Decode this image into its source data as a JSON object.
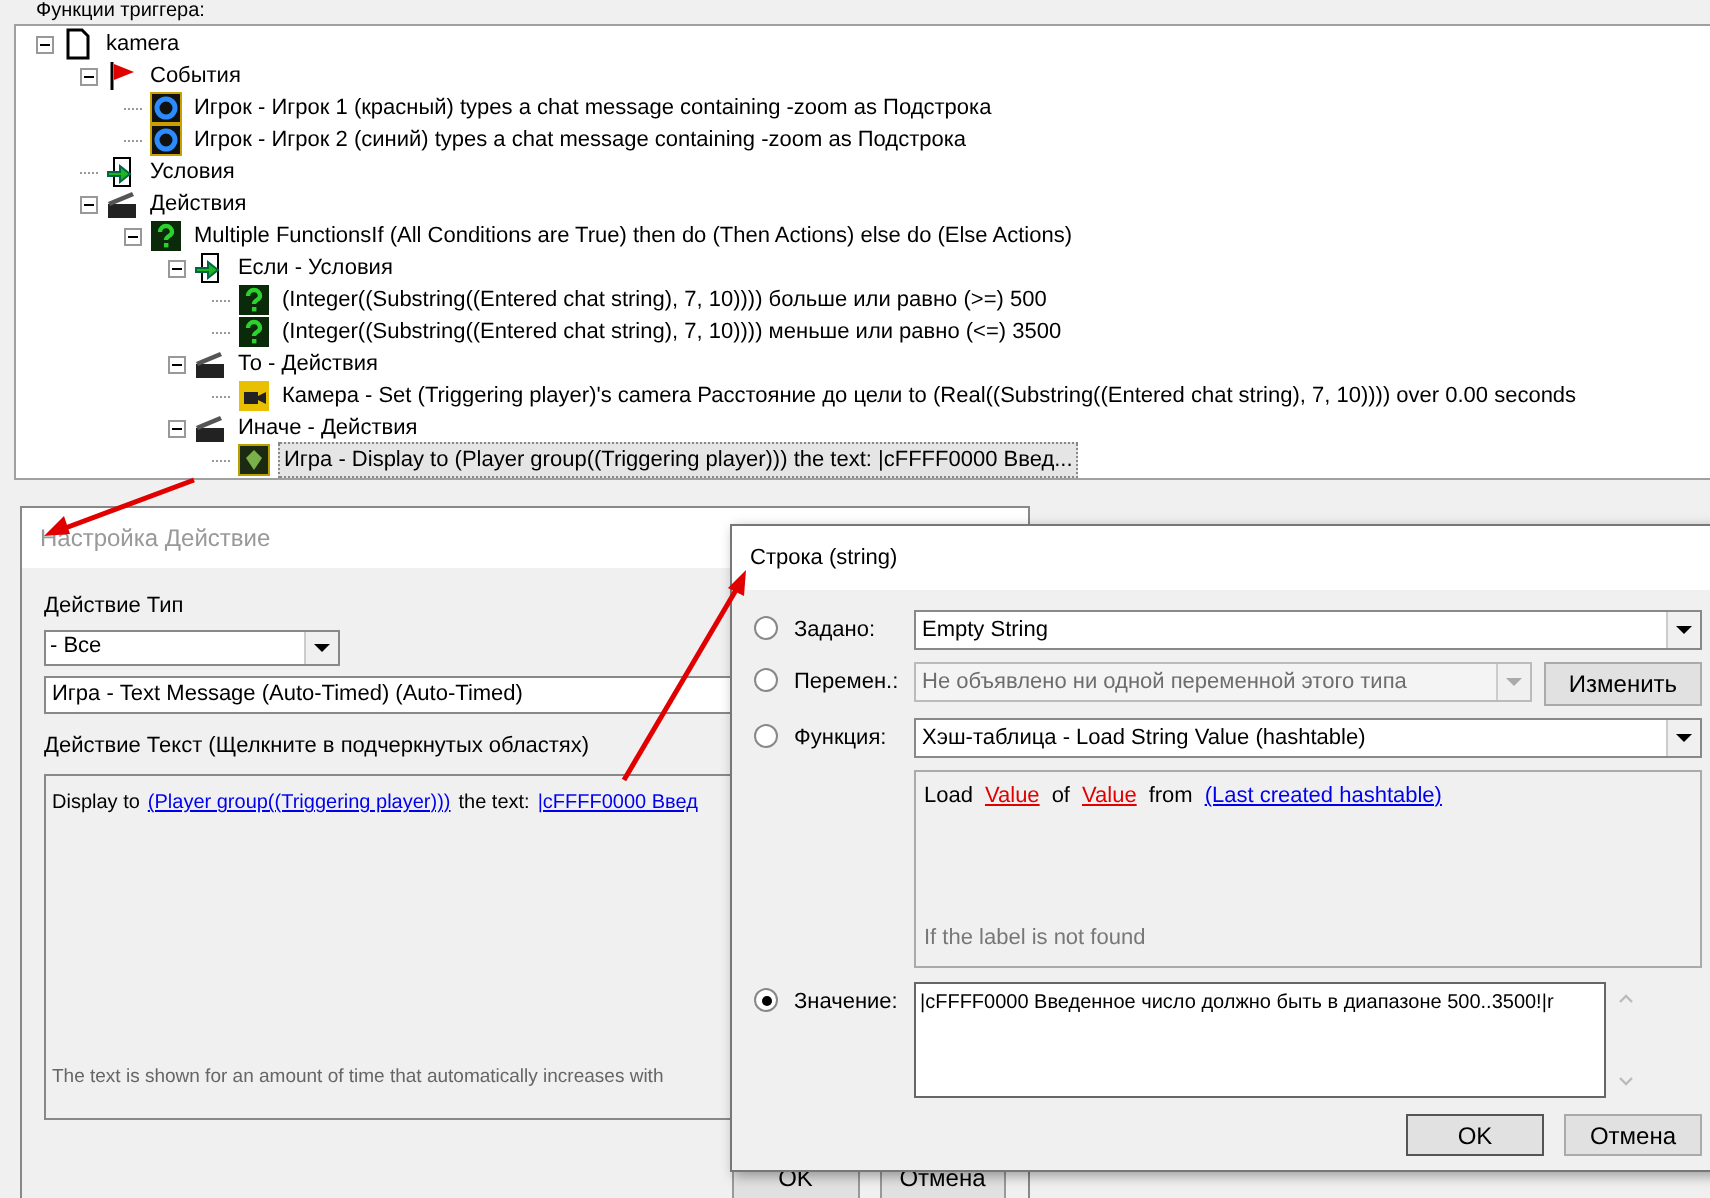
{
  "panel": {
    "title": "Функции триггера:"
  },
  "tree": [
    {
      "label": "kamera",
      "kind": "doc",
      "expanded": true,
      "selected": false,
      "children": [
        {
          "label": "События",
          "kind": "flag",
          "expanded": true,
          "selected": false,
          "children": [
            {
              "label": "Игрок - Игрок 1 (красный) types a chat message containing -zoom as Подстрока",
              "kind": "event",
              "selected": false
            },
            {
              "label": "Игрок - Игрок 2 (синий) types a chat message containing -zoom as Подстрока",
              "kind": "event",
              "selected": false
            }
          ]
        },
        {
          "label": "Условия",
          "kind": "cond",
          "selected": false
        },
        {
          "label": "Действия",
          "kind": "action",
          "expanded": true,
          "selected": false,
          "children": [
            {
              "label": "Multiple FunctionsIf (All Conditions are True) then do (Then Actions) else do (Else Actions)",
              "kind": "multi",
              "expanded": true,
              "selected": false,
              "children": [
                {
                  "label": "Если - Условия",
                  "kind": "cond",
                  "expanded": true,
                  "selected": false,
                  "children": [
                    {
                      "label": "(Integer((Substring((Entered chat string), 7, 10)))) больше или равно (>=) 500",
                      "kind": "multi",
                      "selected": false
                    },
                    {
                      "label": "(Integer((Substring((Entered chat string), 7, 10)))) меньше или равно (<=) 3500",
                      "kind": "multi",
                      "selected": false
                    }
                  ]
                },
                {
                  "label": "То - Действия",
                  "kind": "action",
                  "expanded": true,
                  "selected": false,
                  "children": [
                    {
                      "label": "Камера - Set (Triggering player)'s camera Расстояние до цели to (Real((Substring((Entered chat string), 7, 10)))) over 0.00 seconds",
                      "kind": "camera",
                      "selected": false
                    }
                  ]
                },
                {
                  "label": "Иначе - Действия",
                  "kind": "action",
                  "expanded": true,
                  "selected": false,
                  "children": [
                    {
                      "label": "Игра - Display to (Player group((Triggering player))) the text: |cFFFF0000 Введ...",
                      "kind": "game",
                      "selected": true
                    }
                  ]
                }
              ]
            }
          ]
        }
      ]
    }
  ],
  "action_dialog": {
    "title": "Настройка Действие",
    "type_label": "Действие Тип",
    "type_value": "- Все",
    "action_value": "Игра - Text Message (Auto-Timed) (Auto-Timed)",
    "text_label": "Действие Текст (Щелкните в подчеркнутых областях)",
    "text_segments": [
      {
        "kind": "plain",
        "text": "Display to"
      },
      {
        "kind": "link",
        "text": "(Player group((Triggering player)))"
      },
      {
        "kind": "plain",
        "text": "the text:"
      },
      {
        "kind": "link",
        "text": "|cFFFF0000 Введ"
      }
    ],
    "hint": "The text is shown for an amount of time that automatically increases with",
    "buttons": [
      "OK",
      "Отмена"
    ]
  },
  "string_dialog": {
    "title": "Строка (string)",
    "options": [
      {
        "label": "Задано:",
        "kind": "select",
        "value": "Empty String",
        "selected": false,
        "disabled": false
      },
      {
        "label": "Перемен.:",
        "kind": "select",
        "value": "Не объявлено ни одной переменной этого типа",
        "selected": false,
        "disabled": true,
        "button": "Изменить"
      },
      {
        "label": "Функция:",
        "kind": "function",
        "value": "Хэш-таблица - Load String Value (hashtable)",
        "selected": false,
        "disabled": false,
        "segments": [
          {
            "kind": "plain",
            "text": "Load"
          },
          {
            "kind": "param",
            "text": "Value"
          },
          {
            "kind": "plain",
            "text": "of"
          },
          {
            "kind": "param",
            "text": "Value"
          },
          {
            "kind": "plain",
            "text": "from"
          },
          {
            "kind": "link",
            "text": "(Last created hashtable)"
          }
        ],
        "note": "If the label is not found"
      },
      {
        "label": "Значение:",
        "kind": "text",
        "value": "|cFFFF0000 Введенное число должно быть в диапазоне 500..3500!|r",
        "selected": true,
        "disabled": false
      }
    ],
    "buttons": [
      "OK",
      "Отмена"
    ]
  }
}
